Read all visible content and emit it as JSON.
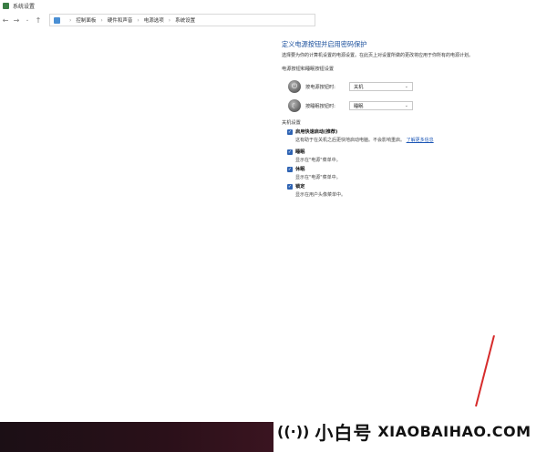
{
  "window": {
    "title": "系统设置"
  },
  "address": {
    "crumbs": [
      "控制面板",
      "硬件和声音",
      "电源选项",
      "系统设置"
    ]
  },
  "page": {
    "heading": "定义电源按钮并启用密码保护",
    "description": "选择要为你的计算机设置的电源设置。在此页上对设置所做的更改将应用于你所有的电源计划。",
    "section_buttons": "电源按钮和睡眠按钮设置",
    "power_button": {
      "label": "按电源按钮时:",
      "value": "关机"
    },
    "sleep_button": {
      "label": "按睡眠按钮时:",
      "value": "睡眠"
    },
    "section_shutdown": "关机设置",
    "options": [
      {
        "label": "启用快速启动(推荐)",
        "desc": "这有助于在关机之后更快地启动电脑。不会影响重启。",
        "link": "了解更多信息",
        "checked": true
      },
      {
        "label": "睡眠",
        "desc": "显示在\"电源\"菜单中。",
        "checked": true
      },
      {
        "label": "休眠",
        "desc": "显示在\"电源\"菜单中。",
        "checked": true
      },
      {
        "label": "锁定",
        "desc": "显示在用户头像菜单中。",
        "checked": true
      }
    ]
  },
  "watermark": {
    "cn": "小白号",
    "en": "XIAOBAIHAO.COM"
  },
  "colors": {
    "accent": "#1a4f9c",
    "checkbox": "#2e63b3",
    "pen_line": "#d62b2b",
    "taskbar": "#2a1019"
  },
  "icons": {
    "app": "control-panel-icon",
    "back": "arrow-left-icon",
    "forward": "arrow-right-icon",
    "recent": "chevron-down-icon",
    "up": "arrow-up-icon",
    "power": "power-icon",
    "sleep": "moon-icon",
    "check": "checkmark-icon",
    "signal": "broadcast-icon"
  }
}
